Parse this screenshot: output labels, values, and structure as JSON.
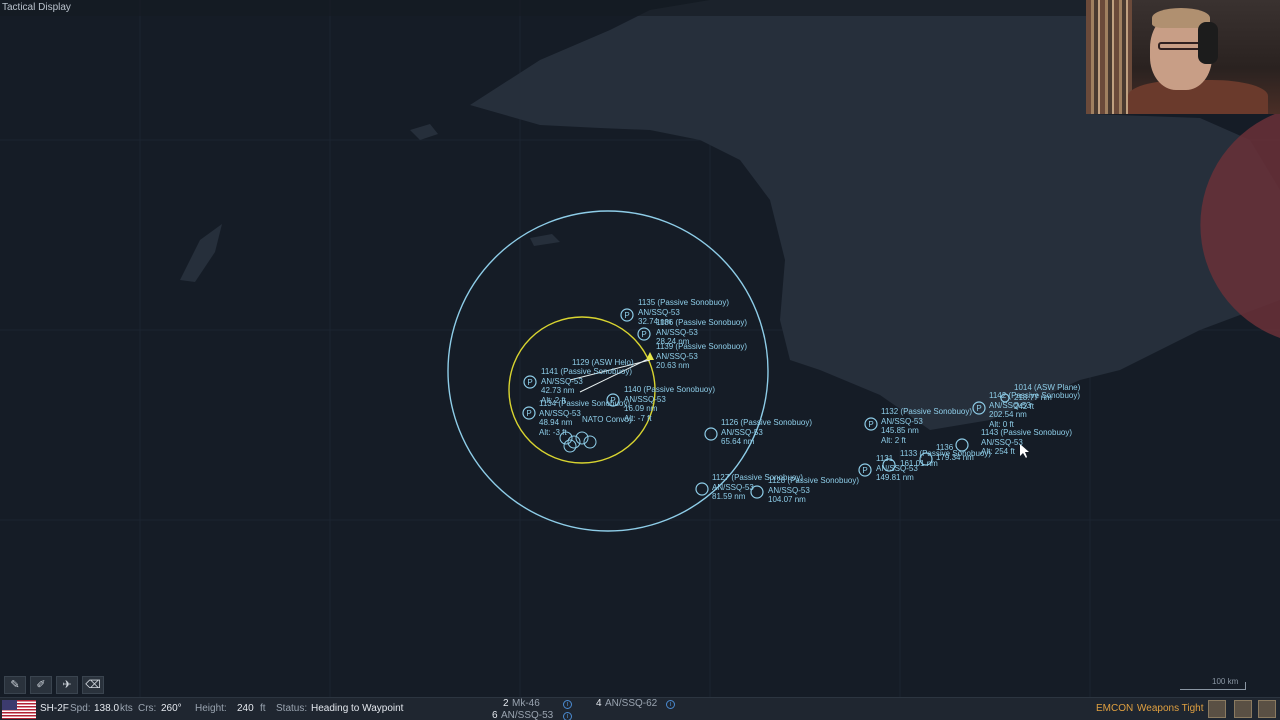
{
  "window": {
    "title": "Tactical Display"
  },
  "colors": {
    "ocean": "#151c26",
    "land": "#262f3b",
    "range_ring": "#8ecde8",
    "sensor_ring": "#d8d430",
    "contact": "#8ecde8",
    "hostile_zone": "#a04850"
  },
  "map_units": [
    {
      "id": "u1135",
      "lines": [
        "1135 (Passive Sonobuoy)",
        "AN/SSQ-53",
        "32.74 nm"
      ],
      "icon": "P"
    },
    {
      "id": "u1136",
      "lines": [
        "1136 (Passive Sonobuoy)",
        "AN/SSQ-53",
        "28.24 nm"
      ],
      "icon": "P"
    },
    {
      "id": "u1139",
      "lines": [
        "1139 (Passive Sonobuoy)",
        "AN/SSQ-53",
        "20.63 nm"
      ],
      "icon": "P"
    },
    {
      "id": "u1129",
      "lines": [
        "1129 (ASW Helo)"
      ],
      "icon": ""
    },
    {
      "id": "u1141",
      "lines": [
        "1141 (Passive Sonobuoy)",
        "AN/SSQ-53",
        "42.73 nm",
        "Alt: 2 ft"
      ],
      "icon": "P"
    },
    {
      "id": "u1134",
      "lines": [
        "1134 (Passive Sonobuoy)",
        "AN/SSQ-53",
        "48.94 nm",
        "Alt: -3 ft"
      ],
      "icon": "P"
    },
    {
      "id": "u1140",
      "lines": [
        "1140 (Passive Sonobuoy)",
        "AN/SSQ-53",
        "16.09 nm",
        "Alt: -7 ft"
      ],
      "icon": "P"
    },
    {
      "id": "u1126",
      "lines": [
        "1126 (Passive Sonobuoy)",
        "AN/SSQ-53",
        "65.64 nm"
      ],
      "icon": ""
    },
    {
      "id": "u1127",
      "lines": [
        "1127 (Passive Sonobuoy)",
        "AN/SSQ-53",
        "81.59 nm"
      ],
      "icon": ""
    },
    {
      "id": "u1128",
      "lines": [
        "1128 (Passive Sonobuoy)",
        "AN/SSQ-53",
        "104.07 nm"
      ],
      "icon": ""
    },
    {
      "id": "u1132",
      "lines": [
        "1132 (Passive Sonobuoy)",
        "AN/SSQ-53",
        "145.85 nm",
        "Alt: 2 ft"
      ],
      "icon": "P"
    },
    {
      "id": "u1131",
      "lines": [
        "1131",
        "AN/SSQ-53",
        "149.81 nm"
      ],
      "icon": "P"
    },
    {
      "id": "u1133",
      "lines": [
        "1133 (Passive Sonobuoy)",
        "161.01 nm"
      ],
      "icon": ""
    },
    {
      "id": "u1130",
      "lines": [
        "1136",
        "179.34 nm"
      ],
      "icon": ""
    },
    {
      "id": "u1142",
      "lines": [
        "1142 (Passive Sonobuoy)",
        "AN/SSQ-53",
        "202.54 nm",
        "Alt: 0 ft"
      ],
      "icon": "P"
    },
    {
      "id": "u1014",
      "lines": [
        "1014 (ASW Plane)",
        "218.77 nm",
        "242 ft"
      ],
      "icon": ""
    },
    {
      "id": "u1143",
      "lines": [
        "1143 (Passive Sonobuoy)",
        "AN/SSQ-53",
        "Alt: 254 ft"
      ],
      "icon": ""
    },
    {
      "id": "convoy",
      "lines": [
        "NATO Convoy"
      ],
      "icon": ""
    }
  ],
  "toolbar": {
    "tools": [
      "✎",
      "✐",
      "✈",
      "⌫"
    ]
  },
  "status": {
    "unit_name": "SH-2F",
    "spd_label": "Spd:",
    "spd_value": "138.0",
    "spd_unit": "kts",
    "crs_label": "Crs:",
    "crs_value": "260°",
    "height_label": "Height:",
    "height_value": "240",
    "height_unit": "ft",
    "status_label": "Status:",
    "status_value": "Heading to Waypoint",
    "weapons": [
      {
        "count": "2",
        "name": "Mk-46"
      },
      {
        "count": "6",
        "name": "AN/SSQ-53"
      },
      {
        "count": "4",
        "name": "AN/SSQ-62"
      }
    ],
    "emcon": "EMCON",
    "weapons_state": "Weapons Tight"
  },
  "scale": {
    "label": "100 km"
  }
}
